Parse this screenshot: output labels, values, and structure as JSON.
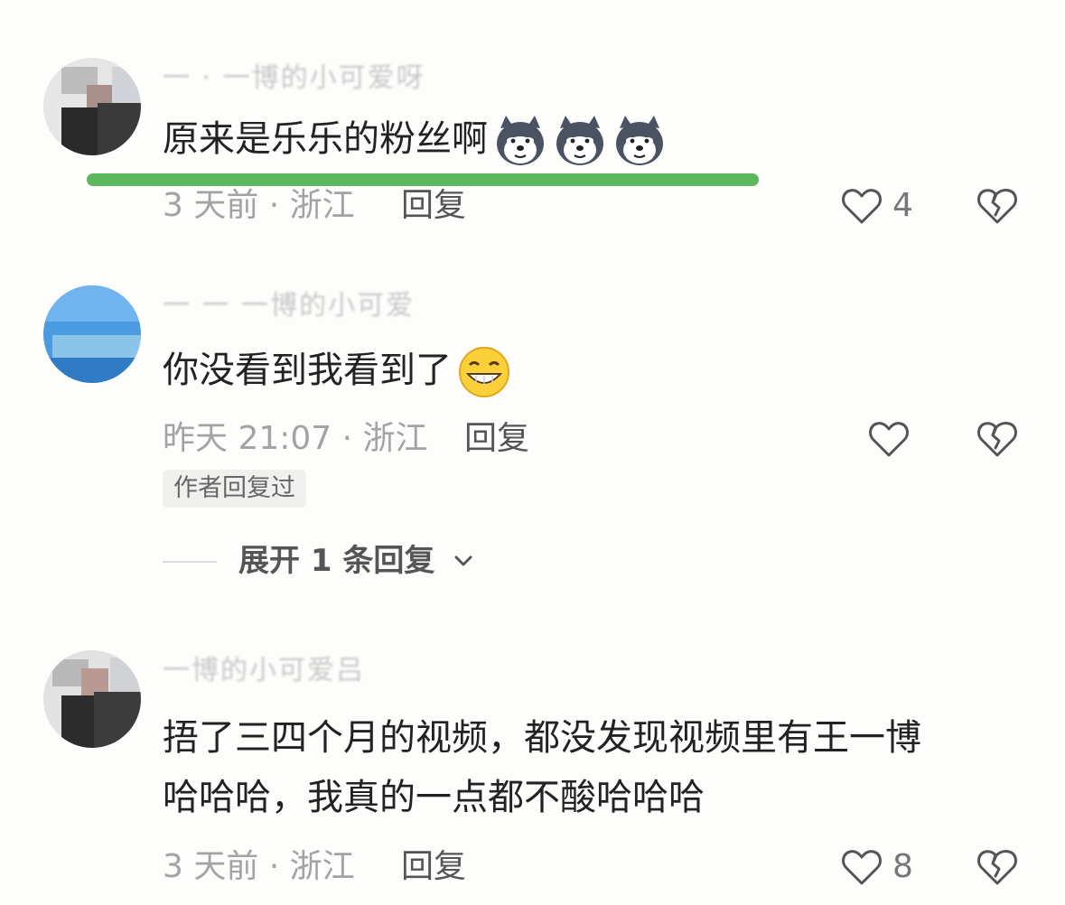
{
  "comments": [
    {
      "username": "一 · 一博的小可爱呀",
      "text_lines": [
        "原来是乐乐的粉丝啊"
      ],
      "emojis": [
        "husky-emoji",
        "husky-emoji",
        "husky-emoji"
      ],
      "time": "3 天前 · 浙江",
      "reply_label": "回复",
      "like_count": "4"
    },
    {
      "username": "一 一 一博的小可爱",
      "text_lines": [
        "你没看到我看到了"
      ],
      "emojis": [
        "grin-emoji"
      ],
      "time": "昨天 21:07 · 浙江",
      "reply_label": "回复",
      "like_count": "",
      "badge": "作者回复过",
      "expand_label": "展开 1 条回复"
    },
    {
      "username": "一博的小可爱吕",
      "text_lines": [
        "捂了三四个月的视频，都没发现视频里有王一博",
        "哈哈哈，我真的一点都不酸哈哈哈"
      ],
      "emojis": [],
      "time": "3 天前 · 浙江",
      "reply_label": "回复",
      "like_count": "8"
    }
  ],
  "colors": {
    "highlight": "#5cb85c",
    "meta_text": "#a3a3a3",
    "icon_stroke": "#555555"
  }
}
